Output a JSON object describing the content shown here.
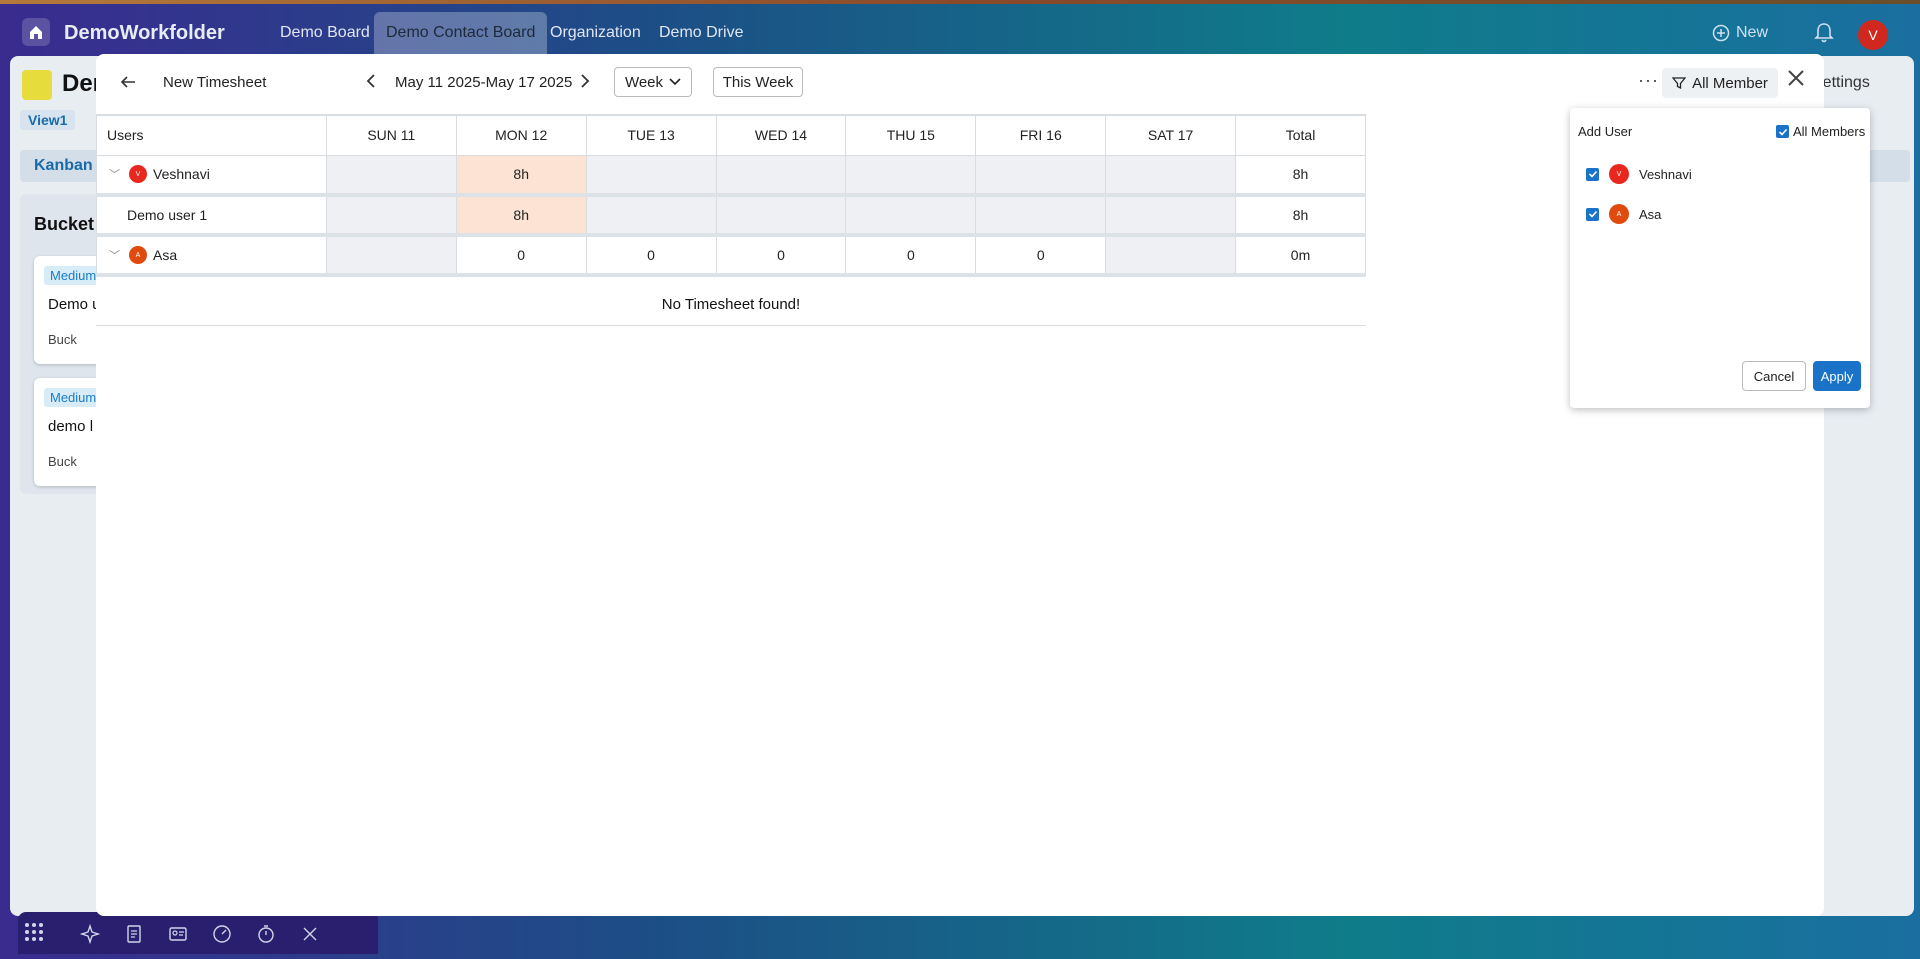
{
  "appbar": {
    "title": "DemoWorkfolder",
    "tabs": [
      "Demo Board",
      "Demo Contact Board",
      "Organization",
      "Demo Drive"
    ],
    "new_label": "New",
    "avatar_letter": "V"
  },
  "board": {
    "title": "Der",
    "settings_label": "Settings",
    "view_label": "View1",
    "kanban_label": "Kanban",
    "bucket_label": "Bucket",
    "cards": [
      {
        "badge": "Medium",
        "title": "Demo u",
        "bucket": "Buck"
      },
      {
        "badge": "Medium",
        "title": "demo l",
        "bucket": "Buck"
      }
    ]
  },
  "modal": {
    "title": "New Timesheet",
    "date_range": "May 11 2025-May 17 2025",
    "week_label": "Week",
    "this_week_label": "This Week",
    "all_member_label": "All Member"
  },
  "table": {
    "headers": [
      "Users",
      "SUN 11",
      "MON 12",
      "TUE 13",
      "WED 14",
      "THU 15",
      "FRI 16",
      "SAT 17",
      "Total"
    ],
    "rows": [
      {
        "name": "Veshnavi",
        "initial": "V",
        "avatar_color": "#e8271f",
        "expandable": true,
        "cells": [
          "",
          "8h",
          "",
          "",
          "",
          "",
          ""
        ],
        "total": "8h"
      },
      {
        "name": "Demo user 1",
        "initial": "",
        "avatar_color": "",
        "expandable": false,
        "cells": [
          "",
          "8h",
          "",
          "",
          "",
          "",
          ""
        ],
        "total": "8h"
      },
      {
        "name": "Asa",
        "initial": "A",
        "avatar_color": "#e04a0f",
        "expandable": true,
        "cells": [
          "",
          "0",
          "0",
          "0",
          "0",
          "0",
          ""
        ],
        "total": "0m"
      }
    ],
    "empty_message": "No Timesheet found!"
  },
  "panel": {
    "title": "Add User",
    "all_members_label": "All Members",
    "users": [
      {
        "name": "Veshnavi",
        "initial": "V",
        "avatar_color": "#e8271f",
        "checked": true
      },
      {
        "name": "Asa",
        "initial": "A",
        "avatar_color": "#e04a0f",
        "checked": true
      }
    ],
    "cancel_label": "Cancel",
    "apply_label": "Apply"
  }
}
